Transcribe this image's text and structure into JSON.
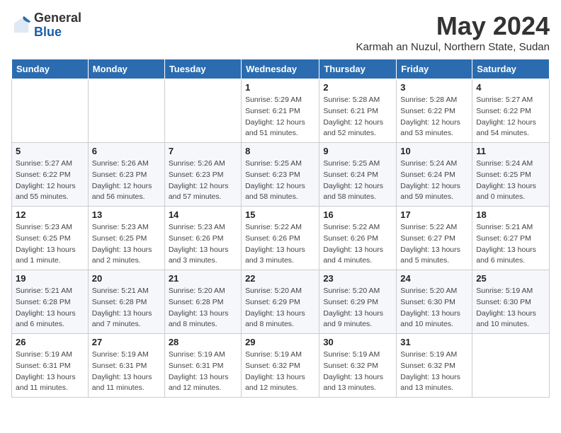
{
  "logo": {
    "general": "General",
    "blue": "Blue"
  },
  "title": "May 2024",
  "subtitle": "Karmah an Nuzul, Northern State, Sudan",
  "days_of_week": [
    "Sunday",
    "Monday",
    "Tuesday",
    "Wednesday",
    "Thursday",
    "Friday",
    "Saturday"
  ],
  "weeks": [
    [
      {
        "day": "",
        "info": ""
      },
      {
        "day": "",
        "info": ""
      },
      {
        "day": "",
        "info": ""
      },
      {
        "day": "1",
        "info": "Sunrise: 5:29 AM\nSunset: 6:21 PM\nDaylight: 12 hours and 51 minutes."
      },
      {
        "day": "2",
        "info": "Sunrise: 5:28 AM\nSunset: 6:21 PM\nDaylight: 12 hours and 52 minutes."
      },
      {
        "day": "3",
        "info": "Sunrise: 5:28 AM\nSunset: 6:22 PM\nDaylight: 12 hours and 53 minutes."
      },
      {
        "day": "4",
        "info": "Sunrise: 5:27 AM\nSunset: 6:22 PM\nDaylight: 12 hours and 54 minutes."
      }
    ],
    [
      {
        "day": "5",
        "info": "Sunrise: 5:27 AM\nSunset: 6:22 PM\nDaylight: 12 hours and 55 minutes."
      },
      {
        "day": "6",
        "info": "Sunrise: 5:26 AM\nSunset: 6:23 PM\nDaylight: 12 hours and 56 minutes."
      },
      {
        "day": "7",
        "info": "Sunrise: 5:26 AM\nSunset: 6:23 PM\nDaylight: 12 hours and 57 minutes."
      },
      {
        "day": "8",
        "info": "Sunrise: 5:25 AM\nSunset: 6:23 PM\nDaylight: 12 hours and 58 minutes."
      },
      {
        "day": "9",
        "info": "Sunrise: 5:25 AM\nSunset: 6:24 PM\nDaylight: 12 hours and 58 minutes."
      },
      {
        "day": "10",
        "info": "Sunrise: 5:24 AM\nSunset: 6:24 PM\nDaylight: 12 hours and 59 minutes."
      },
      {
        "day": "11",
        "info": "Sunrise: 5:24 AM\nSunset: 6:25 PM\nDaylight: 13 hours and 0 minutes."
      }
    ],
    [
      {
        "day": "12",
        "info": "Sunrise: 5:23 AM\nSunset: 6:25 PM\nDaylight: 13 hours and 1 minute."
      },
      {
        "day": "13",
        "info": "Sunrise: 5:23 AM\nSunset: 6:25 PM\nDaylight: 13 hours and 2 minutes."
      },
      {
        "day": "14",
        "info": "Sunrise: 5:23 AM\nSunset: 6:26 PM\nDaylight: 13 hours and 3 minutes."
      },
      {
        "day": "15",
        "info": "Sunrise: 5:22 AM\nSunset: 6:26 PM\nDaylight: 13 hours and 3 minutes."
      },
      {
        "day": "16",
        "info": "Sunrise: 5:22 AM\nSunset: 6:26 PM\nDaylight: 13 hours and 4 minutes."
      },
      {
        "day": "17",
        "info": "Sunrise: 5:22 AM\nSunset: 6:27 PM\nDaylight: 13 hours and 5 minutes."
      },
      {
        "day": "18",
        "info": "Sunrise: 5:21 AM\nSunset: 6:27 PM\nDaylight: 13 hours and 6 minutes."
      }
    ],
    [
      {
        "day": "19",
        "info": "Sunrise: 5:21 AM\nSunset: 6:28 PM\nDaylight: 13 hours and 6 minutes."
      },
      {
        "day": "20",
        "info": "Sunrise: 5:21 AM\nSunset: 6:28 PM\nDaylight: 13 hours and 7 minutes."
      },
      {
        "day": "21",
        "info": "Sunrise: 5:20 AM\nSunset: 6:28 PM\nDaylight: 13 hours and 8 minutes."
      },
      {
        "day": "22",
        "info": "Sunrise: 5:20 AM\nSunset: 6:29 PM\nDaylight: 13 hours and 8 minutes."
      },
      {
        "day": "23",
        "info": "Sunrise: 5:20 AM\nSunset: 6:29 PM\nDaylight: 13 hours and 9 minutes."
      },
      {
        "day": "24",
        "info": "Sunrise: 5:20 AM\nSunset: 6:30 PM\nDaylight: 13 hours and 10 minutes."
      },
      {
        "day": "25",
        "info": "Sunrise: 5:19 AM\nSunset: 6:30 PM\nDaylight: 13 hours and 10 minutes."
      }
    ],
    [
      {
        "day": "26",
        "info": "Sunrise: 5:19 AM\nSunset: 6:31 PM\nDaylight: 13 hours and 11 minutes."
      },
      {
        "day": "27",
        "info": "Sunrise: 5:19 AM\nSunset: 6:31 PM\nDaylight: 13 hours and 11 minutes."
      },
      {
        "day": "28",
        "info": "Sunrise: 5:19 AM\nSunset: 6:31 PM\nDaylight: 13 hours and 12 minutes."
      },
      {
        "day": "29",
        "info": "Sunrise: 5:19 AM\nSunset: 6:32 PM\nDaylight: 13 hours and 12 minutes."
      },
      {
        "day": "30",
        "info": "Sunrise: 5:19 AM\nSunset: 6:32 PM\nDaylight: 13 hours and 13 minutes."
      },
      {
        "day": "31",
        "info": "Sunrise: 5:19 AM\nSunset: 6:32 PM\nDaylight: 13 hours and 13 minutes."
      },
      {
        "day": "",
        "info": ""
      }
    ]
  ]
}
